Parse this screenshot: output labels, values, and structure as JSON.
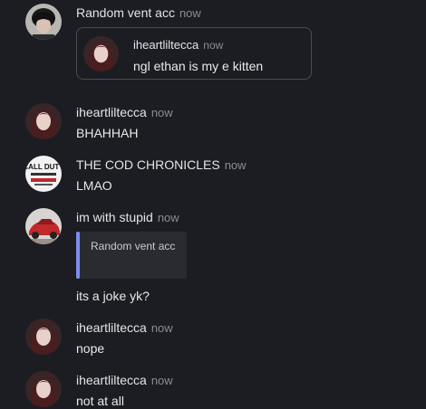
{
  "posts": [
    {
      "author": "Random vent acc",
      "time": "now",
      "avatar_icon": "dark-hair-avatar-icon",
      "quote": {
        "author": "iheartliltecca",
        "time": "now",
        "text": "ngl ethan is my e kitten",
        "avatar_icon": "portrait-avatar-icon"
      }
    },
    {
      "author": "iheartliltecca",
      "time": "now",
      "text": "BHAHHAH",
      "avatar_icon": "portrait-avatar-icon"
    },
    {
      "author": "THE COD CHRONICLES",
      "time": "now",
      "text": "LMAO",
      "avatar_icon": "cod-logo-avatar-icon",
      "avatar_logo_text": "CALL DUTY"
    },
    {
      "author": "im with stupid",
      "time": "now",
      "reply_preview": "Random vent acc",
      "text": "its a joke yk?",
      "avatar_icon": "red-car-avatar-icon"
    },
    {
      "author": "iheartliltecca",
      "time": "now",
      "text": "nope",
      "avatar_icon": "portrait-avatar-icon"
    },
    {
      "author": "iheartliltecca",
      "time": "now",
      "text": "not at all",
      "avatar_icon": "portrait-avatar-icon"
    }
  ],
  "colors": {
    "background": "#1c1d22",
    "reply_accent": "#7c8cf0",
    "muted_text": "#8a8c93"
  }
}
